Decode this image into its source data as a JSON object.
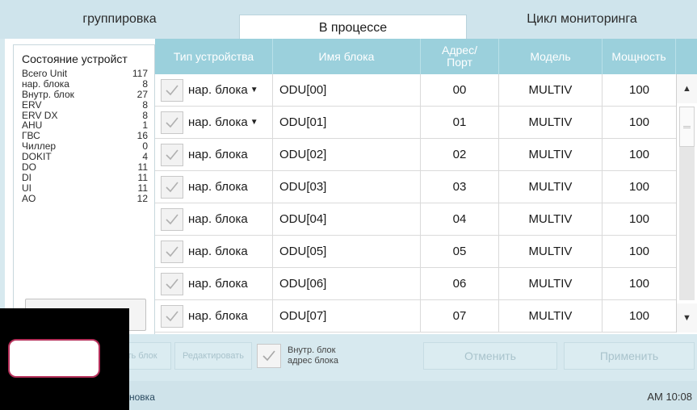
{
  "tabs": [
    {
      "label": "группировка"
    },
    {
      "label": "В процессе"
    },
    {
      "label": "Цикл мониторинга"
    }
  ],
  "status": {
    "title": "Состояние устройст",
    "items": [
      {
        "label": "Всего Unit",
        "count": "117"
      },
      {
        "label": "нар. блока",
        "count": "8"
      },
      {
        "label": "Внутр. блок",
        "count": "27"
      },
      {
        "label": "ERV",
        "count": "8"
      },
      {
        "label": "ERV DX",
        "count": "8"
      },
      {
        "label": "AHU",
        "count": "1"
      },
      {
        "label": "ГВС",
        "count": "16"
      },
      {
        "label": "Чиллер",
        "count": "0"
      },
      {
        "label": "DOKIT",
        "count": "4"
      },
      {
        "label": "DO",
        "count": "11"
      },
      {
        "label": "DI",
        "count": "11"
      },
      {
        "label": "UI",
        "count": "11"
      },
      {
        "label": "AO",
        "count": "12"
      }
    ]
  },
  "table": {
    "headers": [
      "Тип устройства",
      "Имя блока",
      "Адрес/\nПорт",
      "Модель",
      "Мощность"
    ],
    "header_type": "Тип устройства",
    "header_name": "Имя блока",
    "header_addr1": "Адрес/",
    "header_addr2": "Порт",
    "header_model": "Модель",
    "header_power": "Мощность",
    "rows": [
      {
        "type": "нар. блока",
        "dropdown": true,
        "name": "ODU[00]",
        "addr": "00",
        "model": "MULTIV",
        "power": "100"
      },
      {
        "type": "нар. блока",
        "dropdown": true,
        "name": "ODU[01]",
        "addr": "01",
        "model": "MULTIV",
        "power": "100"
      },
      {
        "type": "нар. блока",
        "dropdown": false,
        "name": "ODU[02]",
        "addr": "02",
        "model": "MULTIV",
        "power": "100"
      },
      {
        "type": "нар. блока",
        "dropdown": false,
        "name": "ODU[03]",
        "addr": "03",
        "model": "MULTIV",
        "power": "100"
      },
      {
        "type": "нар. блока",
        "dropdown": false,
        "name": "ODU[04]",
        "addr": "04",
        "model": "MULTIV",
        "power": "100"
      },
      {
        "type": "нар. блока",
        "dropdown": false,
        "name": "ODU[05]",
        "addr": "05",
        "model": "MULTIV",
        "power": "100"
      },
      {
        "type": "нар. блока",
        "dropdown": false,
        "name": "ODU[06]",
        "addr": "06",
        "model": "MULTIV",
        "power": "100"
      },
      {
        "type": "нар. блока",
        "dropdown": false,
        "name": "ODU[07]",
        "addr": "07",
        "model": "MULTIV",
        "power": "100"
      }
    ]
  },
  "actions": {
    "btn1": "ть блок",
    "btn2": "Редактировать",
    "addr_label_1": "Внутр. блок",
    "addr_label_2": "адрес блока",
    "cancel": "Отменить",
    "apply": "Применить"
  },
  "footer": {
    "left": "новка",
    "time": "AM 10:08"
  },
  "colors": {
    "header_bg": "#9bd0dc",
    "app_bg": "#d7e9ef",
    "overlay_border": "#b5305a"
  },
  "icons": {
    "checkbox": "check-icon",
    "dropdown": "caret-down-icon",
    "scroll_up": "arrow-up-icon",
    "scroll_down": "arrow-down-icon"
  }
}
